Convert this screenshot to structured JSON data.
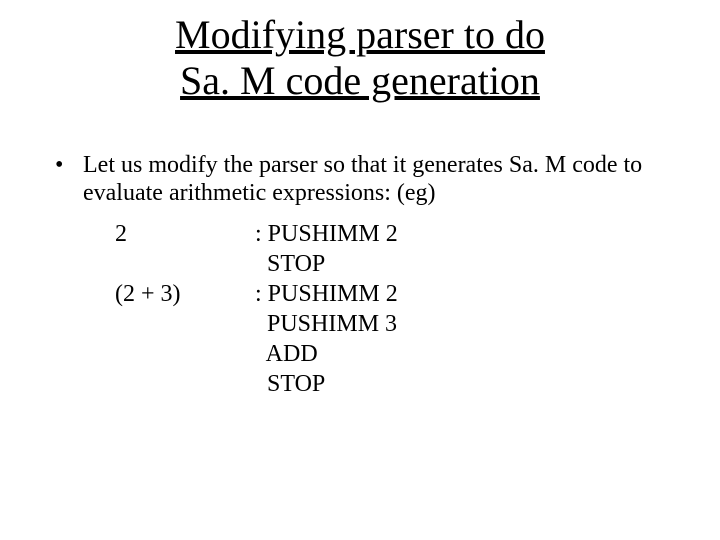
{
  "title_line1": "Modifying parser to do",
  "title_line2": " Sa. M code generation",
  "bullet_text": "Let us modify the parser so that it generates Sa. M code to evaluate arithmetic expressions: (eg)",
  "examples": {
    "ex1_label": "2",
    "ex1_line1": ": PUSHIMM 2",
    "ex1_line2": "  STOP",
    "ex2_label": "(2 + 3)",
    "ex2_line1": ": PUSHIMM 2",
    "ex2_line2": "  PUSHIMM 3",
    "ex2_line3": "  ADD",
    "ex2_line4": "  STOP"
  }
}
